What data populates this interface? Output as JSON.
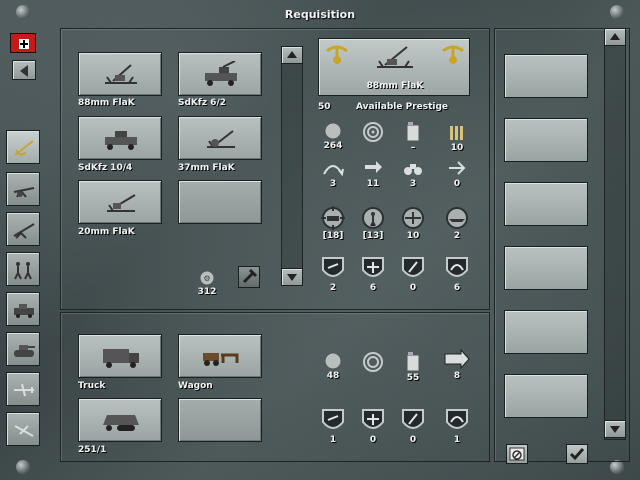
{
  "window": {
    "title": "Requisition"
  },
  "sidebar": {
    "items": [
      {
        "name": "antiair-category",
        "icon": "antiair-icon",
        "active": true
      },
      {
        "name": "artillery-category",
        "icon": "artillery-icon"
      },
      {
        "name": "antitank-category",
        "icon": "antitank-gun-icon"
      },
      {
        "name": "infantry-category",
        "icon": "infantry-icon"
      },
      {
        "name": "recon-category",
        "icon": "recon-vehicle-icon"
      },
      {
        "name": "tank-category",
        "icon": "tank-icon"
      },
      {
        "name": "fighter-category",
        "icon": "fighter-icon"
      },
      {
        "name": "bomber-category",
        "icon": "bomber-icon"
      }
    ]
  },
  "units": [
    {
      "label": "88mm FlaK"
    },
    {
      "label": "SdKfz 6/2"
    },
    {
      "label": "SdKfz 10/4"
    },
    {
      "label": "37mm FlaK"
    },
    {
      "label": "20mm FlaK"
    }
  ],
  "unit_cost": "312",
  "transports": [
    {
      "label": "Truck"
    },
    {
      "label": "Wagon"
    },
    {
      "label": "251/1"
    }
  ],
  "selected": {
    "name": "88mm FlaK",
    "prestige_value": "50",
    "prestige_label": "Available Prestige",
    "stats_row1": [
      "264",
      "",
      "–",
      "10"
    ],
    "stats_row2": [
      "3",
      "11",
      "3",
      "0"
    ],
    "stats_row3": [
      "[18]",
      "[13]",
      "10",
      "2"
    ],
    "stats_row4": [
      "2",
      "6",
      "0",
      "6"
    ]
  },
  "transport_stats": {
    "row1": [
      "48",
      "",
      "55",
      "8"
    ],
    "row2": [
      "1",
      "0",
      "0",
      "1"
    ]
  },
  "colors": {
    "slot": "#a8b1af",
    "text": "#f2f4f4",
    "metal": "#455052"
  }
}
